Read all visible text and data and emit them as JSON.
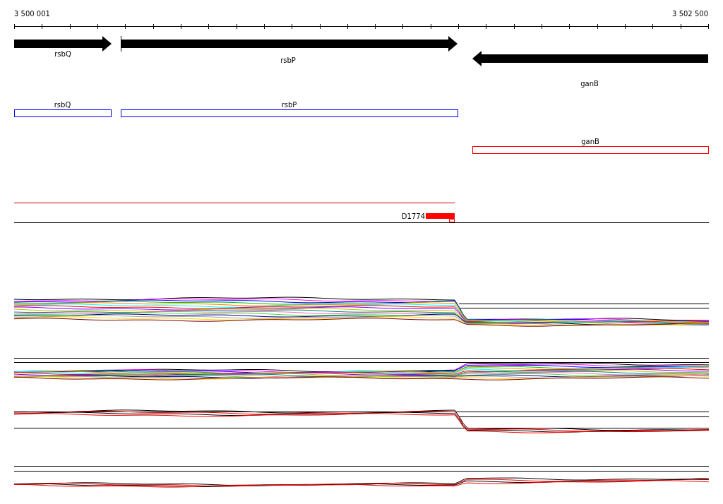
{
  "ruler": {
    "start_label": "3 500 001",
    "end_label": "3 502 500"
  },
  "genes": [
    {
      "name": "rsbQ",
      "reverse": false
    },
    {
      "name": "rsbP",
      "reverse": false
    },
    {
      "name": "ganB",
      "reverse": true
    }
  ],
  "annotations": [
    {
      "name": "rsbQ",
      "color": "#0000ff"
    },
    {
      "name": "rsbP",
      "color": "#0000ff"
    },
    {
      "name": "ganB",
      "color": "#ff0000"
    }
  ],
  "feature": {
    "label": "D1774"
  },
  "signal_tracks": [
    {
      "kind": "multi"
    },
    {
      "kind": "multi"
    },
    {
      "kind": "pair"
    },
    {
      "kind": "pair"
    }
  ]
}
